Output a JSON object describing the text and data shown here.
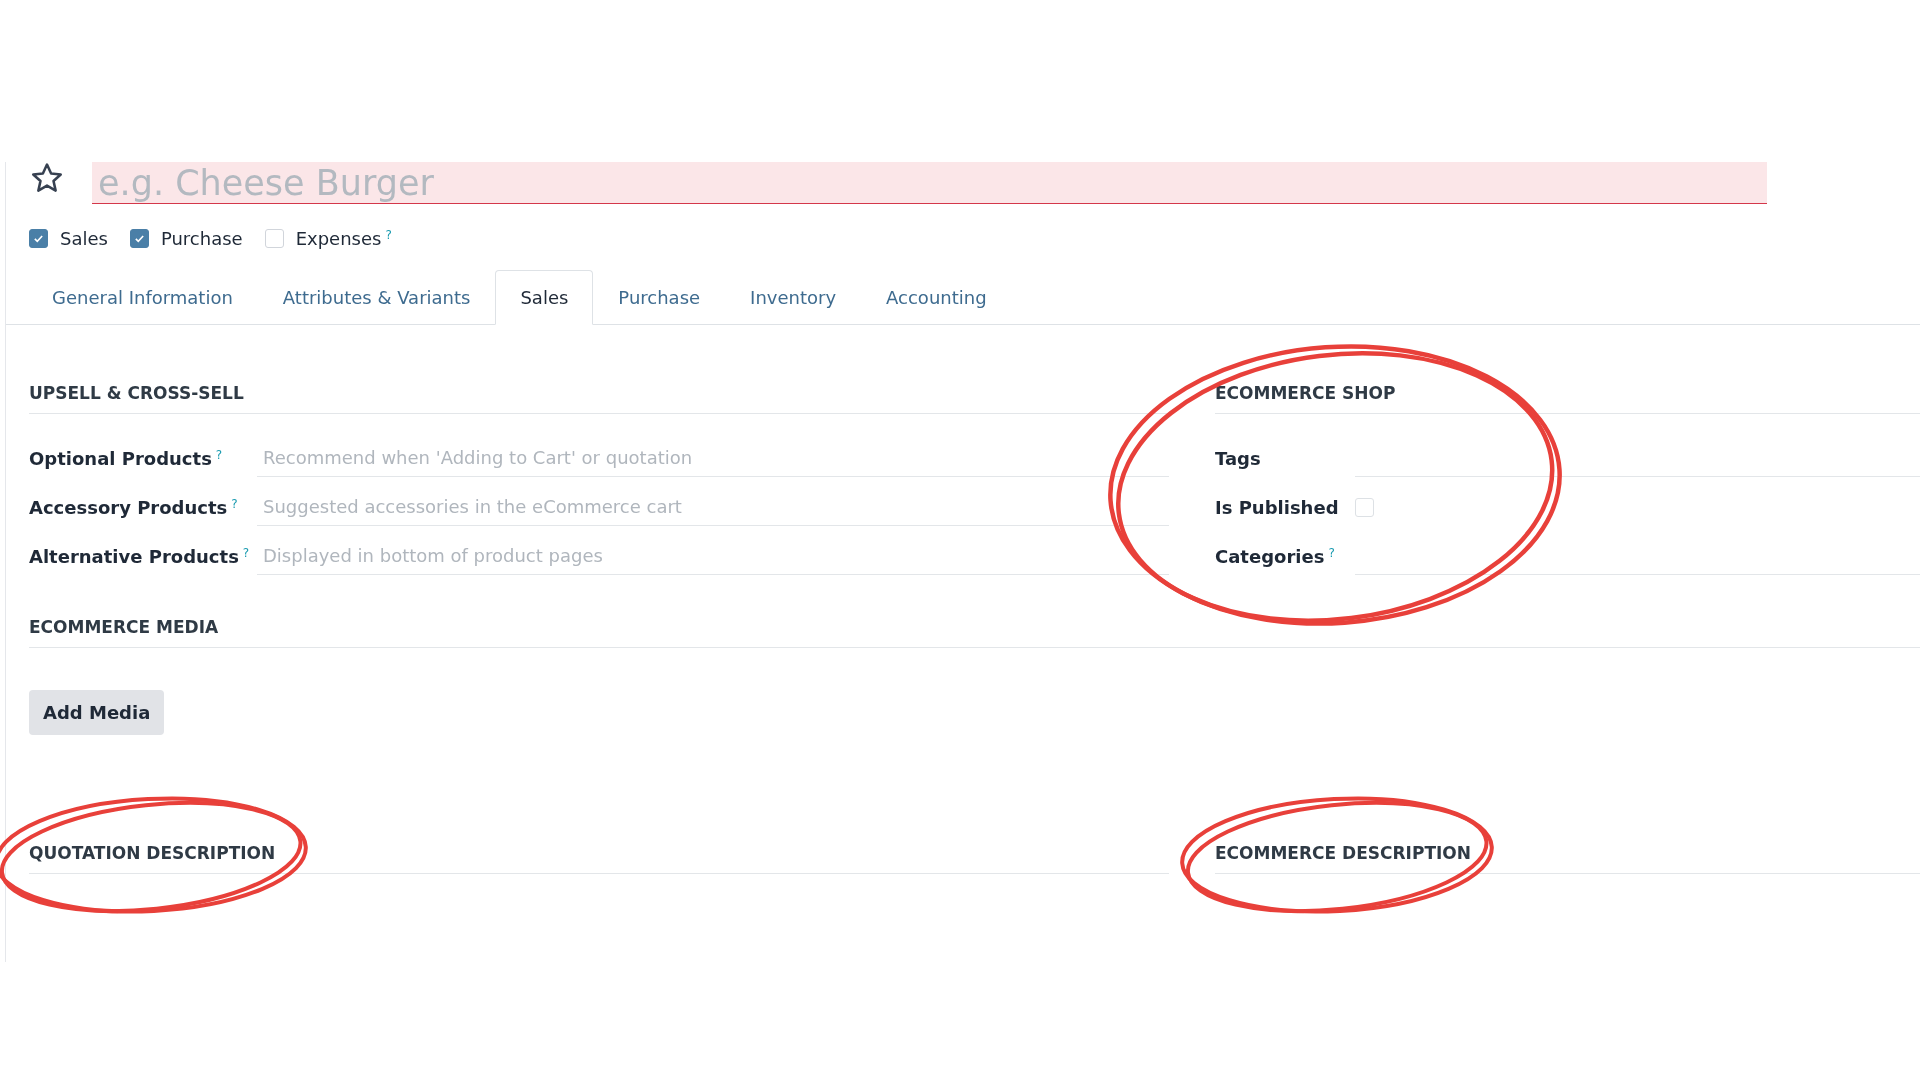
{
  "product": {
    "favorite": false,
    "name_placeholder": "e.g. Cheese Burger"
  },
  "options": [
    {
      "label": "Sales",
      "checked": true
    },
    {
      "label": "Purchase",
      "checked": true
    },
    {
      "label": "Expenses",
      "checked": false,
      "help": "?"
    }
  ],
  "tabs": [
    {
      "label": "General Information",
      "selected": false
    },
    {
      "label": "Attributes & Variants",
      "selected": false
    },
    {
      "label": "Sales",
      "selected": true
    },
    {
      "label": "Purchase",
      "selected": false
    },
    {
      "label": "Inventory",
      "selected": false
    },
    {
      "label": "Accounting",
      "selected": false
    }
  ],
  "upsell": {
    "title": "UPSELL & CROSS-SELL",
    "fields": [
      {
        "label": "Optional Products",
        "help": "?",
        "placeholder": "Recommend when 'Adding to Cart' or quotation"
      },
      {
        "label": "Accessory Products",
        "help": "?",
        "placeholder": "Suggested accessories in the eCommerce cart"
      },
      {
        "label": "Alternative Products",
        "help": "?",
        "placeholder": "Displayed in bottom of product pages"
      }
    ]
  },
  "ecommerce_shop": {
    "title": "ECOMMERCE SHOP",
    "circled": true,
    "fields": [
      {
        "kind": "tags",
        "label": "Tags"
      },
      {
        "kind": "checkbox",
        "label": "Is Published",
        "checked": false
      },
      {
        "kind": "many",
        "label": "Categories",
        "help": "?"
      }
    ]
  },
  "ecommerce_media": {
    "title": "ECOMMERCE MEDIA",
    "button": "Add Media"
  },
  "descriptions": [
    {
      "title": "QUOTATION DESCRIPTION",
      "circled": true
    },
    {
      "title": "ECOMMERCE DESCRIPTION",
      "circled": true
    }
  ]
}
